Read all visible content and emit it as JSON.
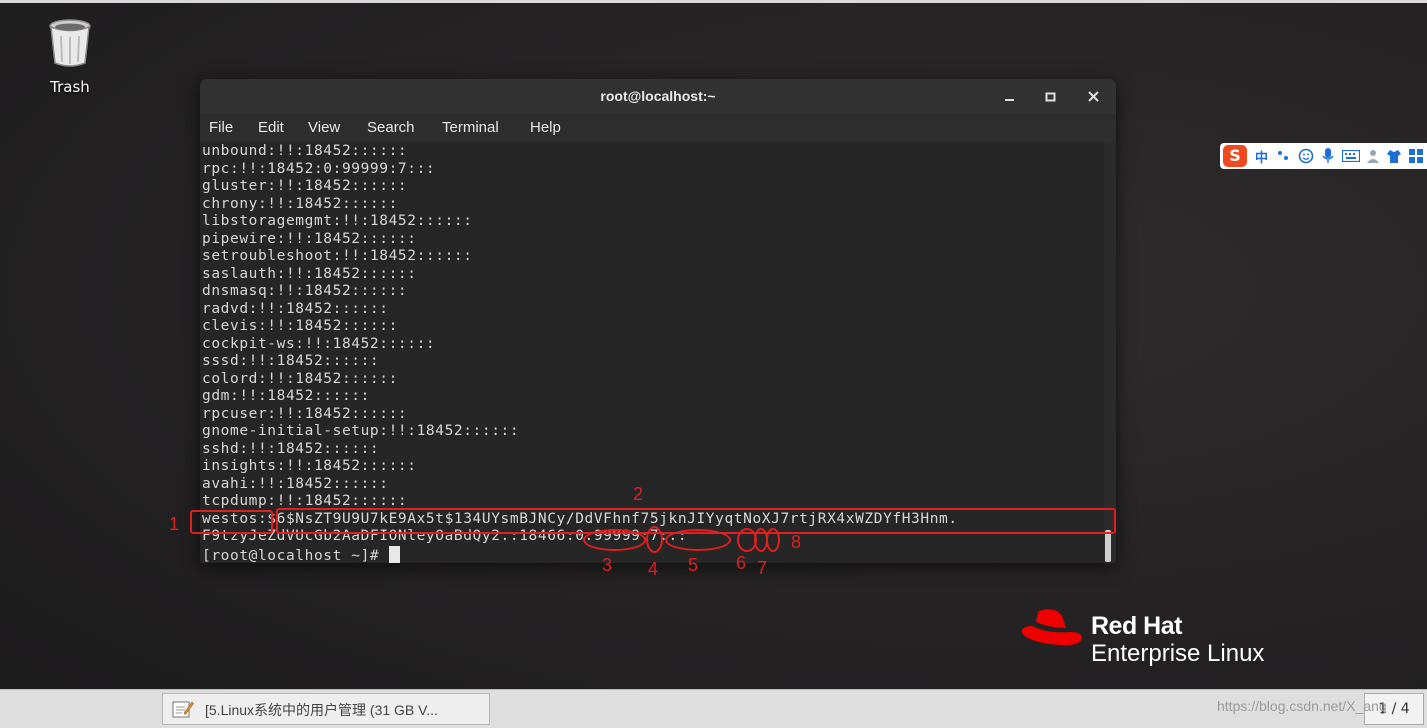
{
  "desktop": {
    "trash_label": "Trash"
  },
  "terminal": {
    "title": "root@localhost:~",
    "menu": [
      "File",
      "Edit",
      "View",
      "Search",
      "Terminal",
      "Help"
    ],
    "lines": [
      "unbound:!!:18452::::::",
      "rpc:!!:18452:0:99999:7:::",
      "gluster:!!:18452::::::",
      "chrony:!!:18452::::::",
      "libstoragemgmt:!!:18452::::::",
      "pipewire:!!:18452::::::",
      "setroubleshoot:!!:18452::::::",
      "saslauth:!!:18452::::::",
      "dnsmasq:!!:18452::::::",
      "radvd:!!:18452::::::",
      "clevis:!!:18452::::::",
      "cockpit-ws:!!:18452::::::",
      "sssd:!!:18452::::::",
      "colord:!!:18452::::::",
      "gdm:!!:18452::::::",
      "rpcuser:!!:18452::::::",
      "gnome-initial-setup:!!:18452::::::",
      "sshd:!!:18452::::::",
      "insights:!!:18452::::::",
      "avahi:!!:18452::::::",
      "tcpdump:!!:18452::::::",
      "westos:$6$NsZT9U9U7kE9Ax5t$134UYsmBJNCy/DdVFhnf75jknJIYyqtNoXJ7rtjRX4xWZDYfH3Hnm.",
      "F9tzyJeZdVUcGb2AaDFIONleyOaBdQy2.:18466:0:99999:7:::"
    ],
    "prompt": "[root@localhost ~]# "
  },
  "annotations": [
    "1",
    "2",
    "3",
    "4",
    "5",
    "6",
    "7",
    "8"
  ],
  "ime": {
    "logo": "S",
    "mode": "中"
  },
  "brand": {
    "line1": "Red Hat",
    "line2": "Enterprise Linux"
  },
  "taskbar": {
    "window_label": "[5.Linux系统中的用户管理 (31 GB V...",
    "pager": "1 / 4",
    "watermark": "https://blog.csdn.net/X_ang"
  },
  "colors": {
    "annotation": "#e02020",
    "redhat": "#ee0000"
  }
}
